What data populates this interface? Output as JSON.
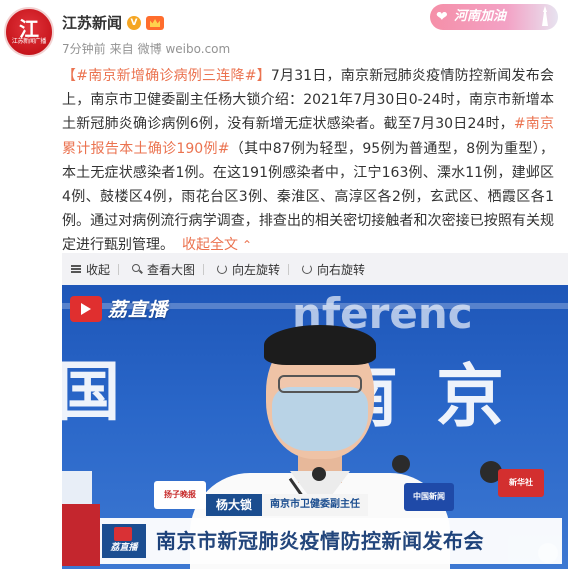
{
  "header": {
    "avatar_glyph": "江",
    "avatar_caption": "江苏新闻广播",
    "user_name": "江苏新闻",
    "verified_badge": "V",
    "time": "7分钟前",
    "source_prefix": "来自",
    "source": "微博 weibo.com",
    "badge_text": "河南加油"
  },
  "post": {
    "tag1": "【#南京新增确诊病例三连降#】",
    "text1": "7月31日，南京新冠肺炎疫情防控新闻发布会上，南京市卫健委副主任杨大锁介绍：2021年7月30日0-24时，南京市新增本土新冠肺炎确诊病例6例，没有新增无症状感染者。截至7月30日24时，",
    "tag2": "#南京累计报告本土确诊190例#",
    "text2": "（其中87例为轻型，95例为普通型，8例为重型），本土无症状感染者1例。在这191例感染者中，江宁163例、溧水11例，建邺区4例、鼓楼区4例，雨花台区3例、秦淮区、高淳区各2例，玄武区、栖霞区各1例。通过对病例流行病学调查，排查出的相关密切接触者和次密接已按照有关规定进行甄别管理。",
    "collapse_label": "收起全文",
    "collapse_arrow": "⌃"
  },
  "toolbar": {
    "items": [
      {
        "label": "收起",
        "icon": "collapse-icon"
      },
      {
        "label": "查看大图",
        "icon": "zoom-icon"
      },
      {
        "label": "向左旋转",
        "icon": "rotate-left-icon"
      },
      {
        "label": "向右旋转",
        "icon": "rotate-right-icon"
      }
    ]
  },
  "photo": {
    "live_logo": "荔直播",
    "bg_word_1": "南京",
    "bg_word_2": "国",
    "bg_word_3": "nferenc",
    "name_tag": "杨大锁",
    "title_tag": "南京市卫健委副主任",
    "headline": "南京市新冠肺炎疫情防控新闻发布会",
    "small_logo": "荔直播",
    "mic_flag_1": "中国新闻",
    "mic_flag_2": "新华社",
    "mic_flag_3": "扬子晚报"
  },
  "colors": {
    "link": "#eb7350",
    "brand_red": "#c8161d",
    "backdrop_blue": "#2a67c9",
    "lower_third_blue": "#1b4d8f"
  }
}
